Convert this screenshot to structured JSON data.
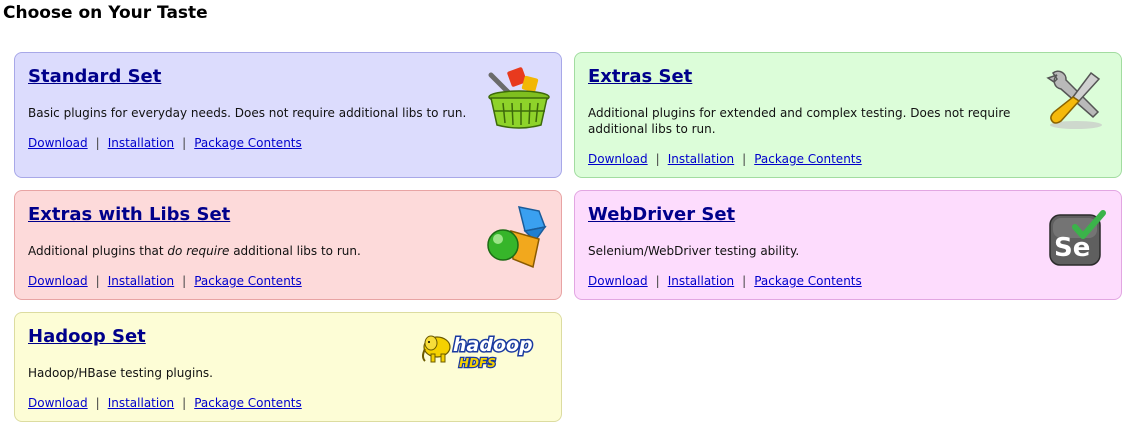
{
  "page": {
    "title": "Choose on Your Taste"
  },
  "cards": {
    "standard": {
      "title": "Standard Set",
      "description": "Basic plugins for everyday needs. Does not require additional libs to run.",
      "links": {
        "download": "Download",
        "installation": "Installation",
        "contents": "Package Contents"
      },
      "separator": "|"
    },
    "extras": {
      "title": "Extras Set",
      "description_line1": "Additional plugins for extended and complex testing. Does not require",
      "description_line2": "additional libs to run.",
      "links": {
        "download": "Download",
        "installation": "Installation",
        "contents": "Package Contents"
      },
      "separator": "|"
    },
    "libs": {
      "title": "Extras with Libs Set",
      "description_before": "Additional plugins that ",
      "description_em": "do require",
      "description_after": " additional libs to run.",
      "links": {
        "download": "Download",
        "installation": "Installation",
        "contents": "Package Contents"
      },
      "separator": "|"
    },
    "webdriver": {
      "title": "WebDriver Set",
      "description": "Selenium/WebDriver testing ability.",
      "links": {
        "download": "Download",
        "installation": "Installation",
        "contents": "Package Contents"
      },
      "separator": "|"
    },
    "hadoop": {
      "title": "Hadoop Set",
      "description": "Hadoop/HBase testing plugins.",
      "links": {
        "download": "Download",
        "installation": "Installation",
        "contents": "Package Contents"
      },
      "separator": "|",
      "logo_text": "hadoop",
      "logo_subtext": "HDFS"
    }
  },
  "icons": {
    "standard": "basket-icon",
    "extras": "tools-icon",
    "libs": "shapes-icon",
    "webdriver": "selenium-icon",
    "hadoop": "hadoop-logo"
  },
  "colors": {
    "standard_bg": "#dcdcfd",
    "extras_bg": "#dcfdd9",
    "libs_bg": "#fddada",
    "webdriver_bg": "#fddcfd",
    "hadoop_bg": "#fdfdd6",
    "title_link": "#00008b",
    "link": "#0000cc"
  }
}
